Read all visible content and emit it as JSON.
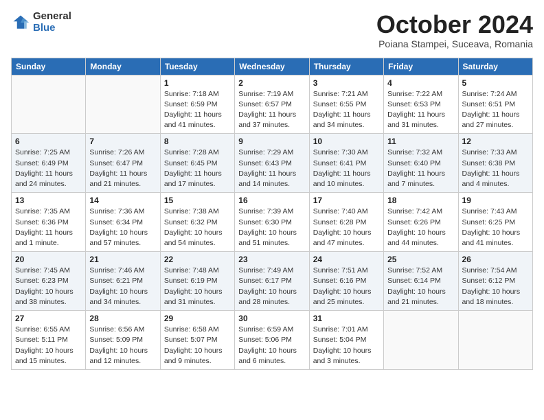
{
  "logo": {
    "general": "General",
    "blue": "Blue"
  },
  "title": "October 2024",
  "subtitle": "Poiana Stampei, Suceava, Romania",
  "headers": [
    "Sunday",
    "Monday",
    "Tuesday",
    "Wednesday",
    "Thursday",
    "Friday",
    "Saturday"
  ],
  "weeks": [
    [
      {
        "day": "",
        "detail": ""
      },
      {
        "day": "",
        "detail": ""
      },
      {
        "day": "1",
        "detail": "Sunrise: 7:18 AM\nSunset: 6:59 PM\nDaylight: 11 hours and 41 minutes."
      },
      {
        "day": "2",
        "detail": "Sunrise: 7:19 AM\nSunset: 6:57 PM\nDaylight: 11 hours and 37 minutes."
      },
      {
        "day": "3",
        "detail": "Sunrise: 7:21 AM\nSunset: 6:55 PM\nDaylight: 11 hours and 34 minutes."
      },
      {
        "day": "4",
        "detail": "Sunrise: 7:22 AM\nSunset: 6:53 PM\nDaylight: 11 hours and 31 minutes."
      },
      {
        "day": "5",
        "detail": "Sunrise: 7:24 AM\nSunset: 6:51 PM\nDaylight: 11 hours and 27 minutes."
      }
    ],
    [
      {
        "day": "6",
        "detail": "Sunrise: 7:25 AM\nSunset: 6:49 PM\nDaylight: 11 hours and 24 minutes."
      },
      {
        "day": "7",
        "detail": "Sunrise: 7:26 AM\nSunset: 6:47 PM\nDaylight: 11 hours and 21 minutes."
      },
      {
        "day": "8",
        "detail": "Sunrise: 7:28 AM\nSunset: 6:45 PM\nDaylight: 11 hours and 17 minutes."
      },
      {
        "day": "9",
        "detail": "Sunrise: 7:29 AM\nSunset: 6:43 PM\nDaylight: 11 hours and 14 minutes."
      },
      {
        "day": "10",
        "detail": "Sunrise: 7:30 AM\nSunset: 6:41 PM\nDaylight: 11 hours and 10 minutes."
      },
      {
        "day": "11",
        "detail": "Sunrise: 7:32 AM\nSunset: 6:40 PM\nDaylight: 11 hours and 7 minutes."
      },
      {
        "day": "12",
        "detail": "Sunrise: 7:33 AM\nSunset: 6:38 PM\nDaylight: 11 hours and 4 minutes."
      }
    ],
    [
      {
        "day": "13",
        "detail": "Sunrise: 7:35 AM\nSunset: 6:36 PM\nDaylight: 11 hours and 1 minute."
      },
      {
        "day": "14",
        "detail": "Sunrise: 7:36 AM\nSunset: 6:34 PM\nDaylight: 10 hours and 57 minutes."
      },
      {
        "day": "15",
        "detail": "Sunrise: 7:38 AM\nSunset: 6:32 PM\nDaylight: 10 hours and 54 minutes."
      },
      {
        "day": "16",
        "detail": "Sunrise: 7:39 AM\nSunset: 6:30 PM\nDaylight: 10 hours and 51 minutes."
      },
      {
        "day": "17",
        "detail": "Sunrise: 7:40 AM\nSunset: 6:28 PM\nDaylight: 10 hours and 47 minutes."
      },
      {
        "day": "18",
        "detail": "Sunrise: 7:42 AM\nSunset: 6:26 PM\nDaylight: 10 hours and 44 minutes."
      },
      {
        "day": "19",
        "detail": "Sunrise: 7:43 AM\nSunset: 6:25 PM\nDaylight: 10 hours and 41 minutes."
      }
    ],
    [
      {
        "day": "20",
        "detail": "Sunrise: 7:45 AM\nSunset: 6:23 PM\nDaylight: 10 hours and 38 minutes."
      },
      {
        "day": "21",
        "detail": "Sunrise: 7:46 AM\nSunset: 6:21 PM\nDaylight: 10 hours and 34 minutes."
      },
      {
        "day": "22",
        "detail": "Sunrise: 7:48 AM\nSunset: 6:19 PM\nDaylight: 10 hours and 31 minutes."
      },
      {
        "day": "23",
        "detail": "Sunrise: 7:49 AM\nSunset: 6:17 PM\nDaylight: 10 hours and 28 minutes."
      },
      {
        "day": "24",
        "detail": "Sunrise: 7:51 AM\nSunset: 6:16 PM\nDaylight: 10 hours and 25 minutes."
      },
      {
        "day": "25",
        "detail": "Sunrise: 7:52 AM\nSunset: 6:14 PM\nDaylight: 10 hours and 21 minutes."
      },
      {
        "day": "26",
        "detail": "Sunrise: 7:54 AM\nSunset: 6:12 PM\nDaylight: 10 hours and 18 minutes."
      }
    ],
    [
      {
        "day": "27",
        "detail": "Sunrise: 6:55 AM\nSunset: 5:11 PM\nDaylight: 10 hours and 15 minutes."
      },
      {
        "day": "28",
        "detail": "Sunrise: 6:56 AM\nSunset: 5:09 PM\nDaylight: 10 hours and 12 minutes."
      },
      {
        "day": "29",
        "detail": "Sunrise: 6:58 AM\nSunset: 5:07 PM\nDaylight: 10 hours and 9 minutes."
      },
      {
        "day": "30",
        "detail": "Sunrise: 6:59 AM\nSunset: 5:06 PM\nDaylight: 10 hours and 6 minutes."
      },
      {
        "day": "31",
        "detail": "Sunrise: 7:01 AM\nSunset: 5:04 PM\nDaylight: 10 hours and 3 minutes."
      },
      {
        "day": "",
        "detail": ""
      },
      {
        "day": "",
        "detail": ""
      }
    ]
  ]
}
